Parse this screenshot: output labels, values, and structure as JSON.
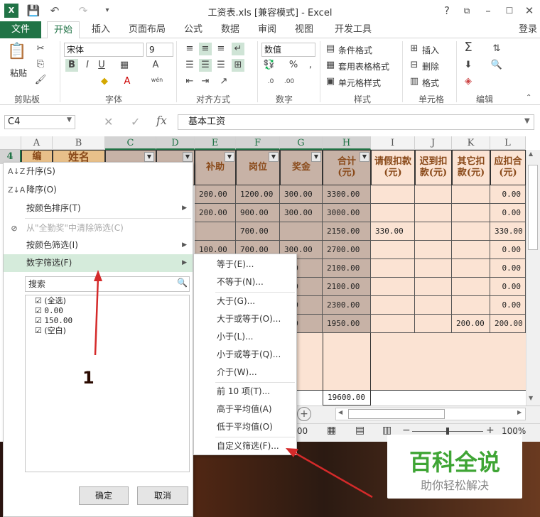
{
  "window": {
    "title": "工资表.xls  [兼容模式] - Excel",
    "help": "?"
  },
  "tabs": [
    "文件",
    "开始",
    "插入",
    "页面布局",
    "公式",
    "数据",
    "审阅",
    "视图",
    "开发工具"
  ],
  "login": "登录",
  "ribbon": {
    "paste": "粘贴",
    "clipboard": "剪贴板",
    "font_name": "宋体",
    "font_size": "9",
    "bold": "B",
    "italic": "I",
    "underline": "U",
    "font_group": "字体",
    "align_group": "对齐方式",
    "number_format": "数值",
    "percent": "%",
    "comma": ",",
    "number_group": "数字",
    "cond_format": "条件格式",
    "table_format": "套用表格格式",
    "cell_style": "单元格样式",
    "styles_group": "样式",
    "insert": "插入",
    "delete": "删除",
    "format": "格式",
    "cells_group": "单元格",
    "edit_group": "编辑",
    "sigma": "Σ",
    "wen": "wén"
  },
  "formula_bar": {
    "name_box": "C4",
    "fx": "fx",
    "content": "基本工资"
  },
  "columns": [
    "A",
    "B",
    "C",
    "D",
    "E",
    "F",
    "G",
    "H",
    "I",
    "J",
    "K",
    "L"
  ],
  "row_num": "4",
  "headers": {
    "A": "编",
    "B": "姓名",
    "E": "补助",
    "F": "岗位",
    "G": "奖金",
    "H": "合计\n(元)",
    "I": "请假扣款\n(元)",
    "J": "迟到扣\n款(元)",
    "K": "其它扣\n款(元)",
    "L": "应扣合\n(元)"
  },
  "rows": [
    {
      "E": "200.00",
      "F": "1200.00",
      "G": "300.00",
      "H": "3300.00",
      "I": "",
      "K": "",
      "L": "0.00"
    },
    {
      "E": "200.00",
      "F": "900.00",
      "G": "300.00",
      "H": "3000.00",
      "I": "",
      "K": "",
      "L": "0.00"
    },
    {
      "E": "",
      "F": "700.00",
      "G": "",
      "H": "2150.00",
      "I": "330.00",
      "K": "",
      "L": "330.00"
    },
    {
      "E": "100.00",
      "F": "700.00",
      "G": "300.00",
      "H": "2700.00",
      "I": "",
      "K": "",
      "L": "0.00"
    },
    {
      "E": "",
      "F": "",
      "G": ".00",
      "H": "2100.00",
      "I": "",
      "K": "",
      "L": "0.00"
    },
    {
      "E": "",
      "F": "",
      "G": ".00",
      "H": "2100.00",
      "I": "",
      "K": "",
      "L": "0.00"
    },
    {
      "E": "",
      "F": "",
      "G": ".00",
      "H": "2300.00",
      "I": "",
      "K": "",
      "L": "0.00"
    },
    {
      "E": "",
      "F": "",
      "G": ".00",
      "H": "1950.00",
      "I": "",
      "K": "200.00",
      "L": "200.00"
    }
  ],
  "total": "19600.00",
  "filter_menu": {
    "items": [
      {
        "label": "升序(S)",
        "icon": "A↓Z"
      },
      {
        "label": "降序(O)",
        "icon": "Z↓A"
      },
      {
        "label": "按颜色排序(T)"
      },
      {
        "label": "从\"全勤奖\"中清除筛选(C)"
      },
      {
        "label": "按颜色筛选(I)"
      },
      {
        "label": "数字筛选(F)"
      }
    ],
    "search_placeholder": "搜索",
    "checklist": [
      "(全选)",
      "0.00",
      "150.00",
      "(空白)"
    ],
    "ok": "确定",
    "cancel": "取消"
  },
  "submenu": [
    "等于(E)...",
    "不等于(N)...",
    "大于(G)...",
    "大于或等于(O)...",
    "小于(L)...",
    "小于或等于(Q)...",
    "介于(W)...",
    "前 10 项(T)...",
    "高于平均值(A)",
    "低于平均值(O)",
    "自定义筛选(F)..."
  ],
  "annotation": "1",
  "status": {
    "value": ".00",
    "zoom": "100%"
  },
  "watermark": {
    "title": "百科全说",
    "subtitle": "助你轻松解决"
  },
  "colors": {
    "excel_green": "#217346",
    "header_fill": "#fbe3d3",
    "data_fill": "#c7b2a6",
    "arrow_red": "#d42a2a"
  }
}
